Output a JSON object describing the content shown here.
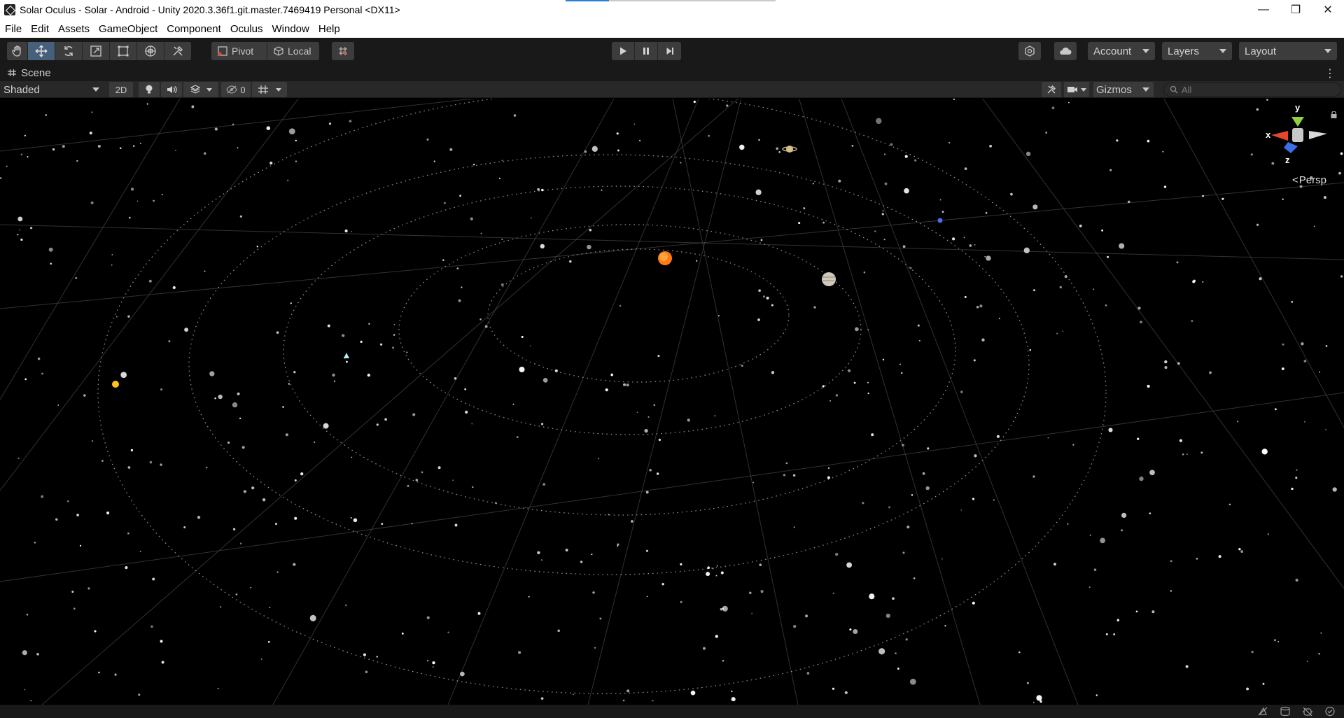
{
  "window": {
    "title": "Solar Oculus - Solar - Android - Unity 2020.3.36f1.git.master.7469419 Personal <DX11>",
    "minimize_glyph": "—",
    "restore_glyph": "❐",
    "close_glyph": "✕"
  },
  "menu": [
    "File",
    "Edit",
    "Assets",
    "GameObject",
    "Component",
    "Oculus",
    "Window",
    "Help"
  ],
  "toolbar": {
    "tools": [
      "hand-tool-icon",
      "move-tool-icon",
      "rotate-tool-icon",
      "scale-tool-icon",
      "rect-tool-icon",
      "transform-tool-icon",
      "custom-tool-icon"
    ],
    "active_tool": "move-tool-icon",
    "pivot_label": "Pivot",
    "local_label": "Local",
    "account_label": "Account",
    "layers_label": "Layers",
    "layout_label": "Layout"
  },
  "scene_tab": {
    "label": "Scene",
    "menu_glyph": "⋮"
  },
  "scene_toolbar": {
    "shading_mode": "Shaded",
    "mode_2d_label": "2D",
    "hidden_count": "0",
    "gizmos_label": "Gizmos",
    "search_placeholder": "All"
  },
  "gizmo": {
    "x_label": "x",
    "y_label": "y",
    "z_label": "z",
    "projection_label": "Persp",
    "colors": {
      "x": "#e8462c",
      "y": "#8fd13f",
      "z": "#3b6ee6"
    }
  },
  "scene": {
    "background": "#000000",
    "sun_color": "#ff7a14",
    "orbit_color": "#cfcfcf",
    "grid_color": "#5a5a5a"
  },
  "statusbar": {
    "icons": [
      "auto-generate-lighting-icon",
      "cache-server-icon",
      "debug-mode-icon",
      "collab-status-icon"
    ]
  }
}
